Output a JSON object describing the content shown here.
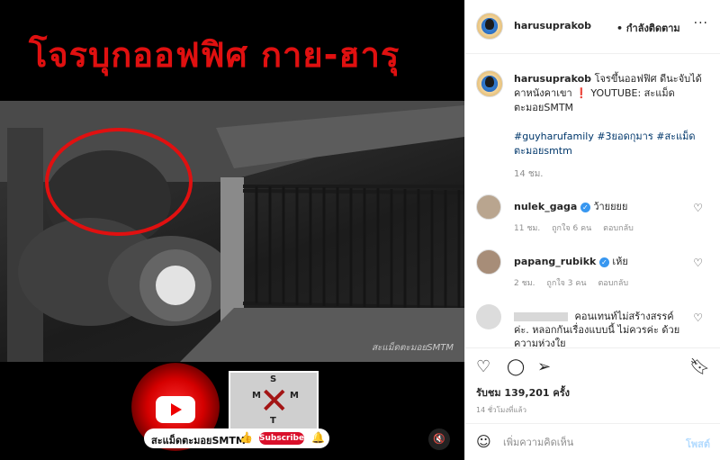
{
  "media": {
    "title": "โจรบุกออฟฟิศ กาย-ฮารุ",
    "watermark": "สะแม็ดตะมอยSMTM",
    "channel_name": "สะแม็ดตะมอยSMTM",
    "subscribe_label": "Subscribe",
    "logo_letters": [
      "S",
      "M",
      "T",
      "M"
    ],
    "mute_icon": "mute-icon"
  },
  "header": {
    "username": "harusuprakob",
    "follow_label": "• กำลังติดตาม",
    "more_label": "···"
  },
  "caption": {
    "username": "harusuprakob",
    "text": "โจรขึ้นออฟฟิศ ดีนะจับได้ คาหนังคาเขา ❗ YOUTUBE: สะแม็ดตะมอยSMTM",
    "hashtags": "#guyharufamily #3ยอดกุมาร #สะแม็ดตะมอยsmtm",
    "time": "14 ชม."
  },
  "comments": [
    {
      "username": "nulek_gaga",
      "verified": true,
      "text": "ว้ายยยย",
      "time": "11 ชม.",
      "likes": "ถูกใจ 6 คน",
      "reply": "ตอบกลับ"
    },
    {
      "username": "papang_rubikk",
      "verified": true,
      "text": "เห้ย",
      "time": "2 ชม.",
      "likes": "ถูกใจ 3 คน",
      "reply": "ตอบกลับ"
    },
    {
      "username": "",
      "verified": false,
      "text": "คอนเทนท์ไม่สร้างสรรค์ค่ะ. หลอกกันเรื่องแบบนี้ ไม่ควรค่ะ ด้วยความห่วงใย",
      "time": "",
      "likes": "",
      "reply": ""
    }
  ],
  "actions": {
    "likes": "รับชม 139,201 ครั้ง",
    "post_time": "14 ชั่วโมงที่แล้ว"
  },
  "comment_box": {
    "placeholder": "เพิ่มความคิดเห็น",
    "post_label": "โพสต์"
  }
}
